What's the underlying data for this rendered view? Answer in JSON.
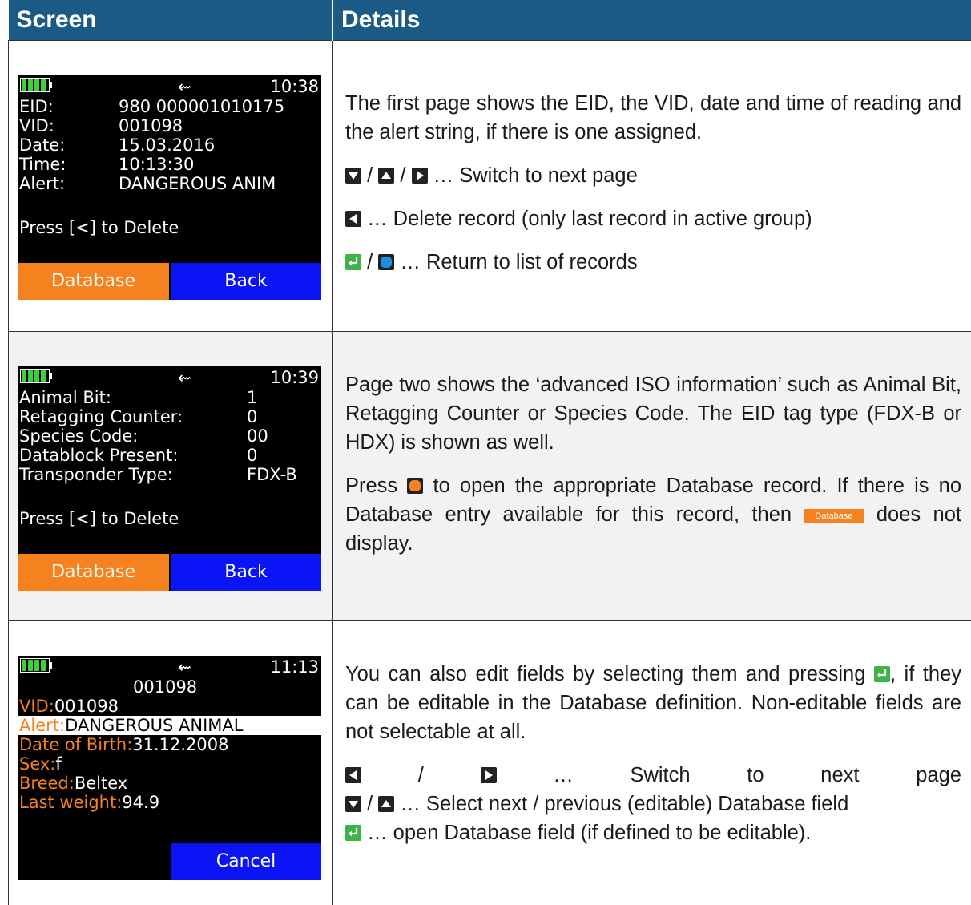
{
  "header": {
    "col_screen": "Screen",
    "col_details": "Details"
  },
  "rows": [
    {
      "screen": {
        "time": "10:38",
        "lines": [
          {
            "label": "EID:",
            "value": "980 000001010175"
          },
          {
            "label": "VID:",
            "value": "001098"
          },
          {
            "label": "Date:",
            "value": "15.03.2016"
          },
          {
            "label": "Time:",
            "value": "10:13:30"
          },
          {
            "label": "Alert:",
            "value": "DANGEROUS ANIM"
          }
        ],
        "prompt": "Press [<] to Delete",
        "btn_left": "Database",
        "btn_right": "Back"
      },
      "details": {
        "para": "The first page shows the EID, the VID, date and time of reading and the alert string, if there is one assigned.",
        "l1_sep1": "/",
        "l1_sep2": "/",
        "l1_text": "… Switch to next page",
        "l2_text": "… Delete record (only last record in active group)",
        "l3_sep": "/",
        "l3_text": "… Return to list of records"
      }
    },
    {
      "screen": {
        "time": "10:39",
        "lines": [
          {
            "label": "Animal Bit:",
            "value": "1"
          },
          {
            "label": "Retagging Counter:",
            "value": "0"
          },
          {
            "label": "Species Code:",
            "value": "00"
          },
          {
            "label": "Datablock Present:",
            "value": "0"
          },
          {
            "label": "Transponder Type:",
            "value": "FDX-B"
          }
        ],
        "prompt": "Press [<] to Delete",
        "btn_left": "Database",
        "btn_right": "Back"
      },
      "details": {
        "para": "Page two shows the ‘advanced ISO information’ such as Animal Bit, Retagging Counter or Species Code. The EID tag type (FDX-B or HDX) is shown as well.",
        "p2_a": "Press",
        "p2_b": "to open the appropriate Database record. If there is no Database entry available for this record, then",
        "p2_badge": "Database",
        "p2_c": "does not display."
      }
    },
    {
      "screen": {
        "time": "11:13",
        "heading": "001098",
        "fields": [
          {
            "label": "VID:",
            "value": "001098"
          },
          {
            "label": "Alert:",
            "value": "DANGEROUS ANIMAL"
          },
          {
            "label": "Date of Birth:",
            "value": "31.12.2008"
          },
          {
            "label": "Sex:",
            "value": "f"
          },
          {
            "label": "Breed:",
            "value": "Beltex"
          },
          {
            "label": "Last weight:",
            "value": "94.9"
          }
        ],
        "btn_right": "Cancel"
      },
      "details": {
        "p1_a": "You can also edit fields by selecting them and pressing",
        "p1_b": ", if they can be editable in the Database definition. Non-editable fields are not selectable at all.",
        "l1_sep": "/",
        "l1_ellipsis": "…",
        "l1_w1": "Switch",
        "l1_w2": "to",
        "l1_w3": "next",
        "l1_w4": "page",
        "l2_sep": "/",
        "l2_text": "… Select next / previous (editable) Database field",
        "l3_text": "… open Database field (if defined to be editable)."
      }
    }
  ],
  "colors": {
    "header_bg": "#1b5a85",
    "orange": "#f5821f",
    "blue": "#0a14f5",
    "green_key": "#3cb44a",
    "blue_key": "#1e8fe0"
  }
}
